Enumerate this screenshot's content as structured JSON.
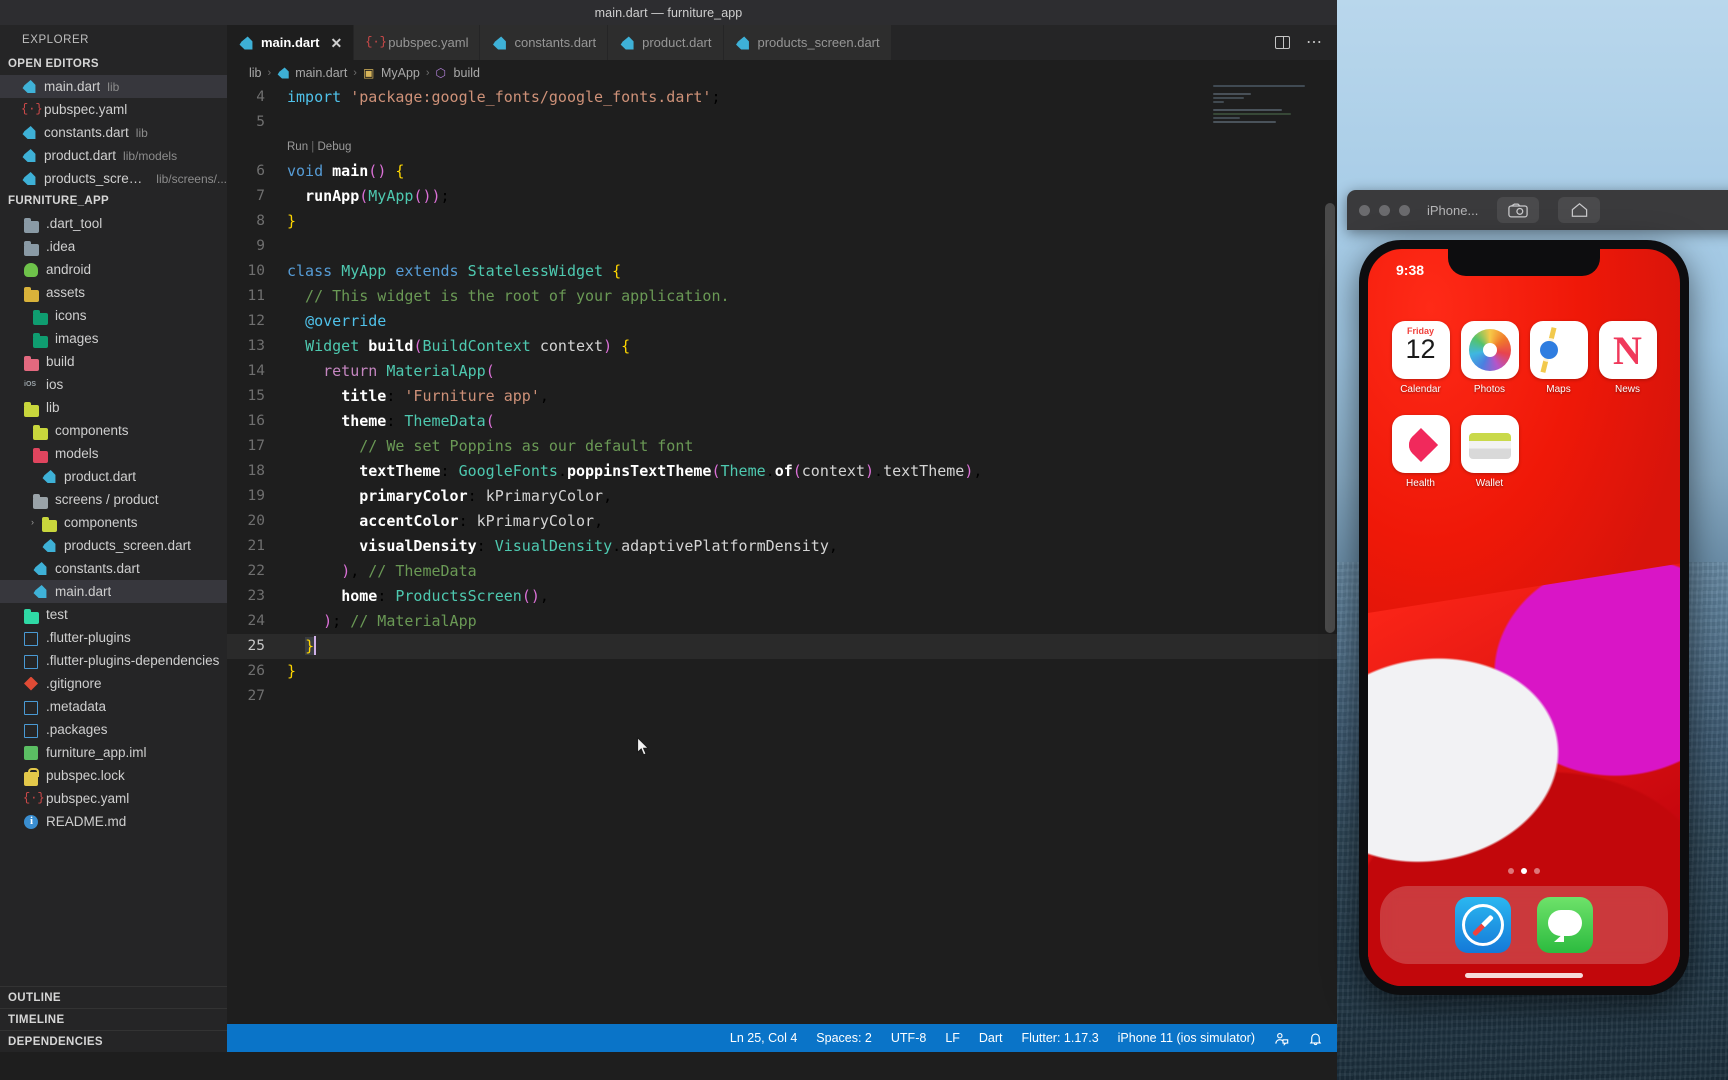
{
  "window": {
    "title": "main.dart — furniture_app"
  },
  "sidebar": {
    "explorer_label": "EXPLORER",
    "open_editors_label": "OPEN EDITORS",
    "project_label": "FURNITURE_APP",
    "open_editors": [
      {
        "name": "main.dart",
        "detail": "lib",
        "icon": "dart-icon",
        "selected": true
      },
      {
        "name": "pubspec.yaml",
        "detail": "",
        "icon": "yaml-icon",
        "selected": false
      },
      {
        "name": "constants.dart",
        "detail": "lib",
        "icon": "dart-icon",
        "selected": false
      },
      {
        "name": "product.dart",
        "detail": "lib/models",
        "icon": "dart-icon",
        "selected": false
      },
      {
        "name": "products_screen.dart",
        "detail": "lib/screens/...",
        "icon": "dart-icon",
        "selected": false
      }
    ],
    "tree": [
      {
        "name": ".dart_tool",
        "icon": "folder-gray-icon",
        "indent": 1,
        "type": "folder",
        "selected": false
      },
      {
        "name": ".idea",
        "icon": "folder-gray-icon",
        "indent": 1,
        "type": "folder",
        "selected": false
      },
      {
        "name": "android",
        "icon": "android-icon",
        "indent": 1,
        "type": "folder",
        "selected": false
      },
      {
        "name": "assets",
        "icon": "folder-yellow-icon",
        "indent": 1,
        "type": "folder",
        "selected": false
      },
      {
        "name": "icons",
        "icon": "folder-green-icon",
        "indent": 2,
        "type": "folder",
        "selected": false
      },
      {
        "name": "images",
        "icon": "folder-green-icon",
        "indent": 2,
        "type": "folder",
        "selected": false
      },
      {
        "name": "build",
        "icon": "folder-pink-icon",
        "indent": 1,
        "type": "folder",
        "selected": false
      },
      {
        "name": "ios",
        "icon": "ios-icon",
        "indent": 1,
        "type": "folder",
        "selected": false
      },
      {
        "name": "lib",
        "icon": "folder-lime-icon",
        "indent": 1,
        "type": "folder",
        "selected": false
      },
      {
        "name": "components",
        "icon": "folder-lime-icon",
        "indent": 2,
        "type": "folder",
        "selected": false
      },
      {
        "name": "models",
        "icon": "folder-red-icon",
        "indent": 2,
        "type": "folder",
        "selected": false
      },
      {
        "name": "product.dart",
        "icon": "dart-icon",
        "indent": 3,
        "type": "file",
        "selected": false
      },
      {
        "name": "screens / product",
        "icon": "folder-plain-icon",
        "indent": 2,
        "type": "folder",
        "selected": false
      },
      {
        "name": "components",
        "icon": "folder-lime-icon",
        "indent": 3,
        "type": "folder",
        "selected": false,
        "twisty": "›"
      },
      {
        "name": "products_screen.dart",
        "icon": "dart-icon",
        "indent": 3,
        "type": "file",
        "selected": false
      },
      {
        "name": "constants.dart",
        "icon": "dart-icon",
        "indent": 2,
        "type": "file",
        "selected": false
      },
      {
        "name": "main.dart",
        "icon": "dart-icon",
        "indent": 2,
        "type": "file",
        "selected": true
      },
      {
        "name": "test",
        "icon": "folder-teal-icon",
        "indent": 1,
        "type": "folder",
        "selected": false
      },
      {
        "name": ".flutter-plugins",
        "icon": "file-icon",
        "indent": 1,
        "type": "file",
        "selected": false
      },
      {
        "name": ".flutter-plugins-dependencies",
        "icon": "file-icon",
        "indent": 1,
        "type": "file",
        "selected": false
      },
      {
        "name": ".gitignore",
        "icon": "git-icon",
        "indent": 1,
        "type": "file",
        "selected": false
      },
      {
        "name": ".metadata",
        "icon": "file-icon",
        "indent": 1,
        "type": "file",
        "selected": false
      },
      {
        "name": ".packages",
        "icon": "file-icon",
        "indent": 1,
        "type": "file",
        "selected": false
      },
      {
        "name": "furniture_app.iml",
        "icon": "iml-icon",
        "indent": 1,
        "type": "file",
        "selected": false
      },
      {
        "name": "pubspec.lock",
        "icon": "lock-icon",
        "indent": 1,
        "type": "file",
        "selected": false
      },
      {
        "name": "pubspec.yaml",
        "icon": "yaml-icon",
        "indent": 1,
        "type": "file",
        "selected": false
      },
      {
        "name": "README.md",
        "icon": "markdown-icon",
        "indent": 1,
        "type": "file",
        "selected": false
      }
    ],
    "bottom_sections": [
      "OUTLINE",
      "TIMELINE",
      "DEPENDENCIES"
    ]
  },
  "tabs": [
    {
      "label": "main.dart",
      "icon": "dart-icon",
      "active": true,
      "close": "✕"
    },
    {
      "label": "pubspec.yaml",
      "icon": "yaml-icon",
      "active": false
    },
    {
      "label": "constants.dart",
      "icon": "dart-icon",
      "active": false
    },
    {
      "label": "product.dart",
      "icon": "dart-icon",
      "active": false
    },
    {
      "label": "products_screen.dart",
      "icon": "dart-icon",
      "active": false
    }
  ],
  "breadcrumb": [
    {
      "label": "lib",
      "icon": "folder-icon"
    },
    {
      "label": "main.dart",
      "icon": "dart-icon"
    },
    {
      "label": "MyApp",
      "icon": "class-icon"
    },
    {
      "label": "build",
      "icon": "method-icon"
    }
  ],
  "codelens": {
    "run": "Run",
    "sep": "|",
    "debug": "Debug"
  },
  "code": {
    "first_line_number": 4,
    "lines": [
      {
        "n": 4,
        "text": "import 'package:google_fonts/google_fonts.dart';"
      },
      {
        "n": 5,
        "text": ""
      },
      {
        "n": 6,
        "text": "void main() {"
      },
      {
        "n": 7,
        "text": "  runApp(MyApp());"
      },
      {
        "n": 8,
        "text": "}"
      },
      {
        "n": 9,
        "text": ""
      },
      {
        "n": 10,
        "text": "class MyApp extends StatelessWidget {"
      },
      {
        "n": 11,
        "text": "  // This widget is the root of your application."
      },
      {
        "n": 12,
        "text": "  @override"
      },
      {
        "n": 13,
        "text": "  Widget build(BuildContext context) {"
      },
      {
        "n": 14,
        "text": "    return MaterialApp("
      },
      {
        "n": 15,
        "text": "      title: 'Furniture app',"
      },
      {
        "n": 16,
        "text": "      theme: ThemeData("
      },
      {
        "n": 17,
        "text": "        // We set Poppins as our default font"
      },
      {
        "n": 18,
        "text": "        textTheme: GoogleFonts.poppinsTextTheme(Theme.of(context).textTheme),"
      },
      {
        "n": 19,
        "text": "        primaryColor: kPrimaryColor,"
      },
      {
        "n": 20,
        "text": "        accentColor: kPrimaryColor,"
      },
      {
        "n": 21,
        "text": "        visualDensity: VisualDensity.adaptivePlatformDensity,"
      },
      {
        "n": 22,
        "text": "      ), // ThemeData"
      },
      {
        "n": 23,
        "text": "      home: ProductsScreen(),"
      },
      {
        "n": 24,
        "text": "    ); // MaterialApp"
      },
      {
        "n": 25,
        "text": "  }"
      },
      {
        "n": 26,
        "text": "}"
      },
      {
        "n": 27,
        "text": ""
      }
    ]
  },
  "statusbar": {
    "position": "Ln 25, Col 4",
    "spaces": "Spaces: 2",
    "encoding": "UTF-8",
    "eol": "LF",
    "language": "Dart",
    "flutter": "Flutter: 1.17.3",
    "device": "iPhone 11 (ios simulator)",
    "feedback_icon": "feedback-icon",
    "bell_icon": "bell-icon",
    "accent": "#0a74c8"
  },
  "simulator": {
    "window_title": "iPhone...",
    "status_time": "9:38",
    "apps": [
      {
        "label": "Calendar",
        "icon": "calendar-icon",
        "day": "Friday",
        "date": "12"
      },
      {
        "label": "Photos",
        "icon": "photos-icon"
      },
      {
        "label": "Maps",
        "icon": "maps-icon"
      },
      {
        "label": "News",
        "icon": "news-icon"
      },
      {
        "label": "Health",
        "icon": "health-icon"
      },
      {
        "label": "Wallet",
        "icon": "wallet-icon"
      }
    ],
    "dock": [
      {
        "label": "Safari",
        "icon": "safari-icon"
      },
      {
        "label": "Messages",
        "icon": "messages-icon"
      }
    ],
    "page_dots": 3,
    "active_page": 2
  }
}
